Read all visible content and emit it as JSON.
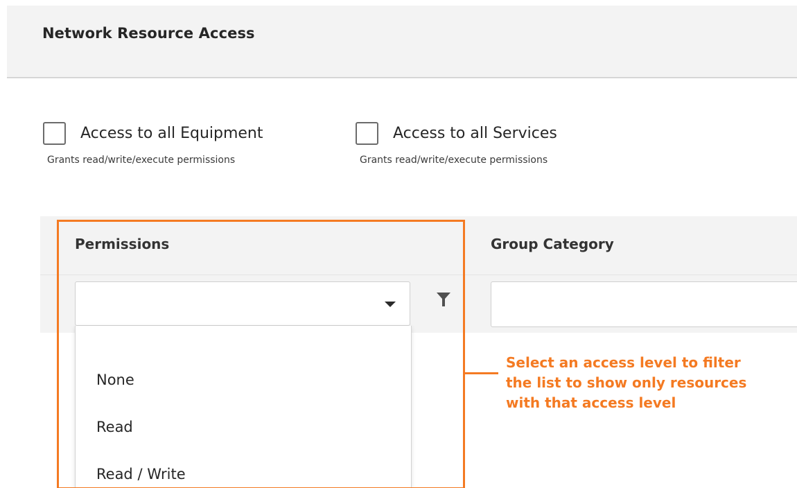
{
  "header": {
    "title": "Network Resource Access"
  },
  "access_options": [
    {
      "label": "Access to all Equipment",
      "help": "Grants read/write/execute permissions",
      "checked": false
    },
    {
      "label": "Access to all Services",
      "help": "Grants read/write/execute permissions",
      "checked": false
    }
  ],
  "grid": {
    "columns": [
      {
        "title": "Permissions"
      },
      {
        "title": "Group Category"
      }
    ],
    "permissions_filter": {
      "value": "",
      "options": [
        "None",
        "Read",
        "Read / Write"
      ]
    },
    "group_category_filter": {
      "value": ""
    }
  },
  "annotation": {
    "color": "#f47a22",
    "lines": [
      "Select an access level to filter",
      "the list to show only resources",
      "with that access level"
    ]
  },
  "icons": {
    "dropdown": "caret-down-icon",
    "filter": "filter-funnel-icon"
  }
}
